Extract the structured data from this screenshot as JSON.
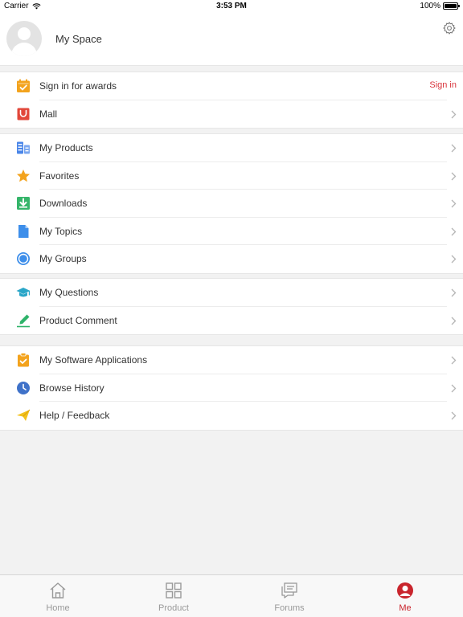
{
  "status_bar": {
    "carrier": "Carrier",
    "time": "3:53 PM",
    "battery": "100%"
  },
  "profile": {
    "name": "My Space"
  },
  "groups": [
    {
      "items": [
        {
          "label": "Sign in for awards",
          "icon": "calendar-check-icon",
          "action_text": "Sign in"
        },
        {
          "label": "Mall",
          "icon": "shopping-bag-icon"
        }
      ]
    },
    {
      "items": [
        {
          "label": "My Products",
          "icon": "products-icon"
        },
        {
          "label": "Favorites",
          "icon": "star-icon"
        },
        {
          "label": "Downloads",
          "icon": "download-icon"
        },
        {
          "label": "My Topics",
          "icon": "document-icon"
        },
        {
          "label": "My Groups",
          "icon": "groups-icon"
        }
      ]
    },
    {
      "items": [
        {
          "label": "My Questions",
          "icon": "graduation-cap-icon"
        },
        {
          "label": "Product Comment",
          "icon": "pen-icon"
        }
      ]
    },
    {
      "items": [
        {
          "label": "My Software Applications",
          "icon": "clipboard-icon"
        },
        {
          "label": "Browse History",
          "icon": "clock-icon"
        },
        {
          "label": "Help / Feedback",
          "icon": "paper-plane-icon"
        }
      ]
    }
  ],
  "tabbar": [
    {
      "label": "Home",
      "icon": "home-icon"
    },
    {
      "label": "Product",
      "icon": "grid-icon"
    },
    {
      "label": "Forums",
      "icon": "chat-icon"
    },
    {
      "label": "Me",
      "icon": "person-icon",
      "active": true
    }
  ],
  "colors": {
    "accent": "#c9252d",
    "sign_in": "#d9363e"
  }
}
